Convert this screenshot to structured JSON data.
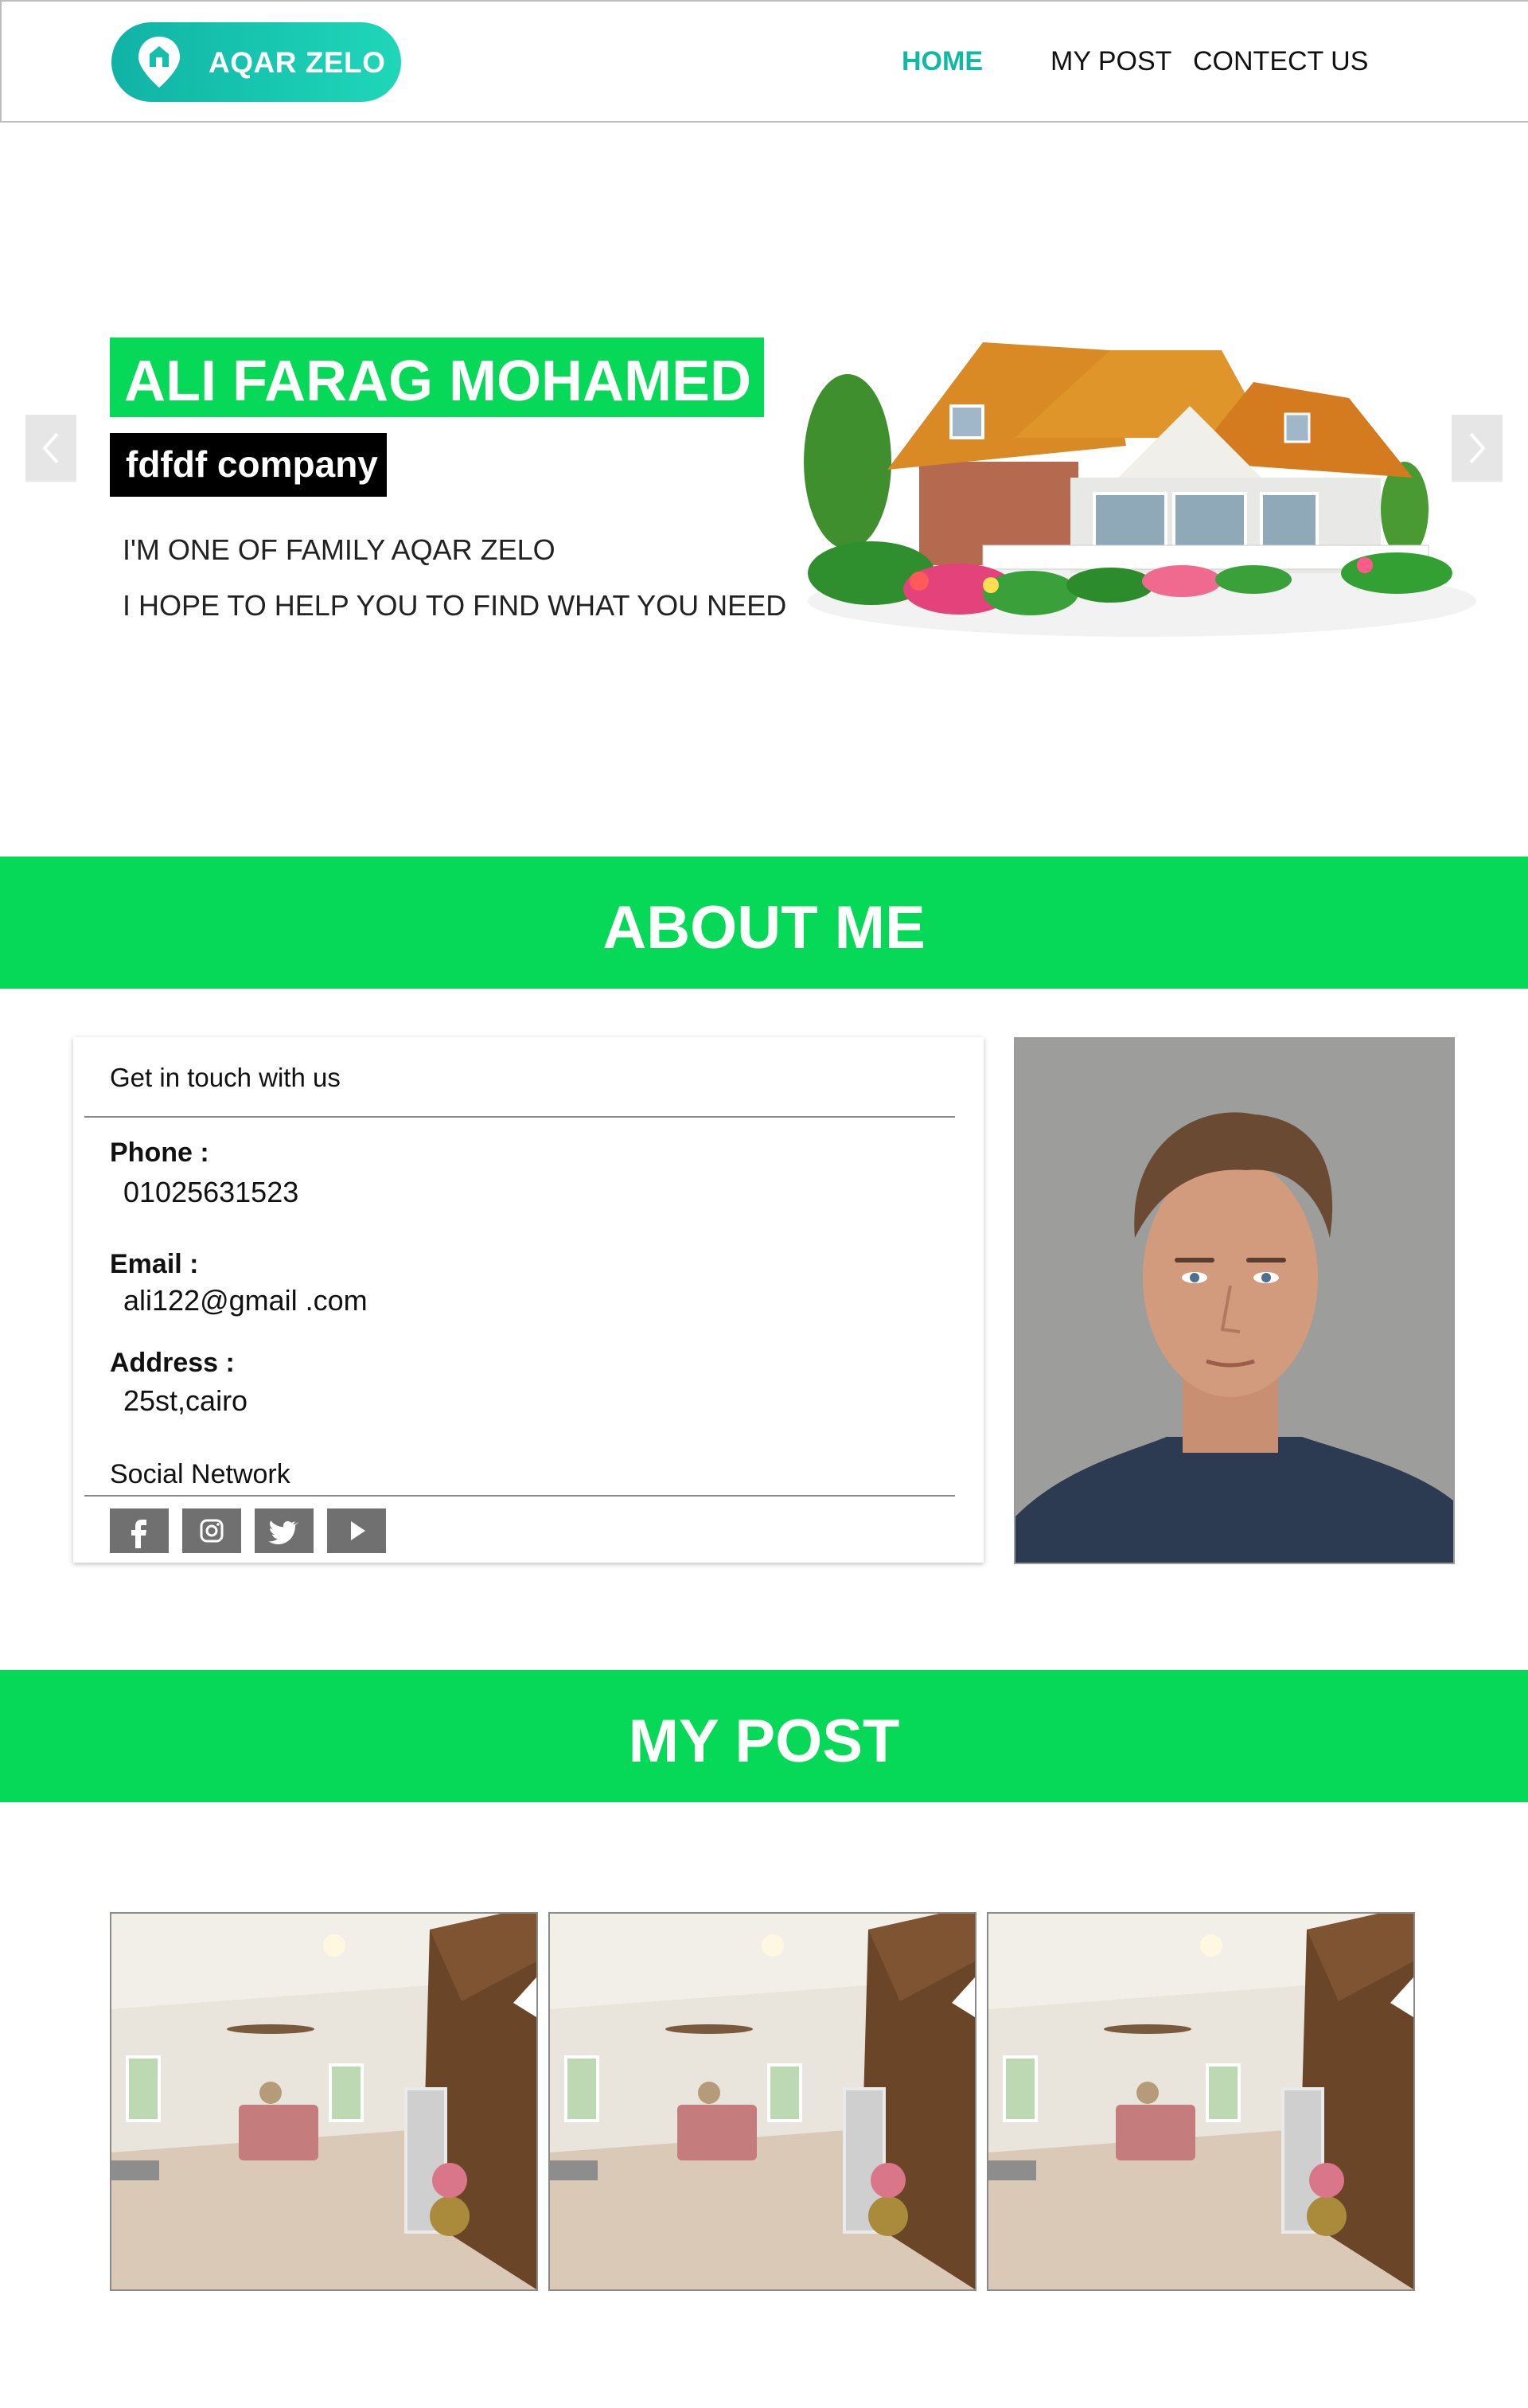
{
  "brand": {
    "name": "AQAR ZELO",
    "gradient_start": "#10b3a6",
    "gradient_end": "#1fd7b8"
  },
  "nav": {
    "home": "HOME",
    "my_post": "MY POST",
    "contact": "CONTECT US",
    "active_color": "#12b9a2"
  },
  "hero": {
    "name": "ALI FARAG MOHAMED",
    "company": "fdfdf company",
    "line1": "I'M ONE OF FAMILY AQAR ZELO",
    "line2": "I HOPE TO HELP YOU TO FIND WHAT YOU NEED",
    "accent": "#05d957"
  },
  "about": {
    "heading": "ABOUT ME",
    "card_title": "Get in touch with us",
    "phone_label": "Phone :",
    "phone": "01025631523",
    "email_label": "Email :",
    "email": "ali122@gmail .com",
    "address_label": "Address :",
    "address": "25st,cairo",
    "social_label": "Social Network",
    "social": [
      "facebook-icon",
      "instagram-icon",
      "twitter-icon",
      "youtube-icon"
    ]
  },
  "posts": {
    "heading": "MY POST",
    "items": [
      "bedroom-photo",
      "bedroom-photo",
      "bedroom-photo"
    ]
  }
}
